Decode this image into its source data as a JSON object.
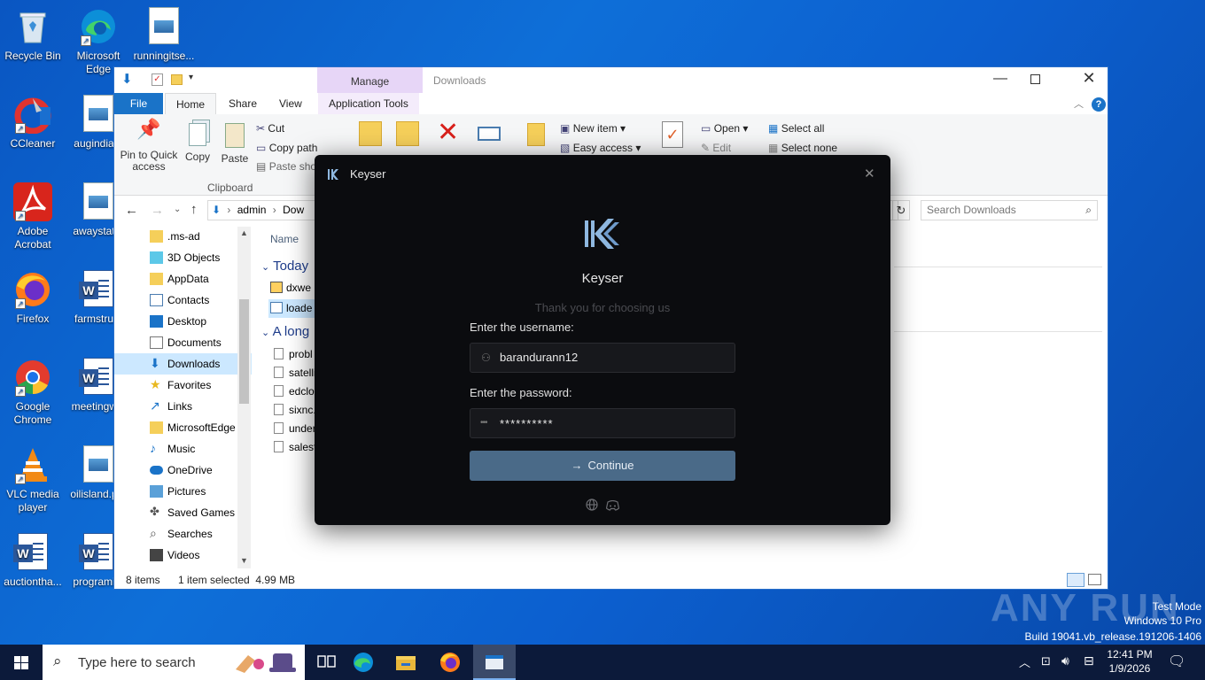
{
  "desktop": {
    "icons": [
      {
        "label": "Recycle Bin"
      },
      {
        "label": "Microsoft Edge"
      },
      {
        "label": "runningitse..."
      },
      {
        "label": "CCleaner"
      },
      {
        "label": "augindia..."
      },
      {
        "label": "Adobe Acrobat"
      },
      {
        "label": "awaystat..."
      },
      {
        "label": "Firefox"
      },
      {
        "label": "farmstru..."
      },
      {
        "label": "Google Chrome"
      },
      {
        "label": "meetingw..."
      },
      {
        "label": "VLC media player"
      },
      {
        "label": "oilisland.p..."
      },
      {
        "label": "auctiontha..."
      },
      {
        "label": "programi..."
      }
    ]
  },
  "explorer": {
    "window_title": "Downloads",
    "manage_label": "Manage",
    "tabs": [
      "File",
      "Home",
      "Share",
      "View",
      "Application Tools"
    ],
    "ribbon": {
      "pin_label": "Pin to Quick access",
      "copy_label": "Copy",
      "paste_label": "Paste",
      "cut_label": "Cut",
      "copy_path_label": "Copy path",
      "paste_shortcut_label": "Paste sho...",
      "clipboard_group": "Clipboard",
      "new_item_label": "New item",
      "easy_access_label": "Easy access",
      "open_label": "Open",
      "edit_label": "Edit",
      "select_all_label": "Select all",
      "select_none_label": "Select none"
    },
    "address": {
      "segments": [
        "admin",
        "Dow"
      ]
    },
    "search_placeholder": "Search Downloads",
    "sidebar": [
      {
        "label": ".ms-ad",
        "icon": "folder-icon"
      },
      {
        "label": "3D Objects",
        "icon": "3d-objects-icon"
      },
      {
        "label": "AppData",
        "icon": "folder-icon"
      },
      {
        "label": "Contacts",
        "icon": "contacts-icon"
      },
      {
        "label": "Desktop",
        "icon": "desktop-icon"
      },
      {
        "label": "Documents",
        "icon": "documents-icon"
      },
      {
        "label": "Downloads",
        "icon": "downloads-icon",
        "selected": true
      },
      {
        "label": "Favorites",
        "icon": "star-icon"
      },
      {
        "label": "Links",
        "icon": "links-icon"
      },
      {
        "label": "MicrosoftEdge",
        "icon": "folder-icon"
      },
      {
        "label": "Music",
        "icon": "music-icon"
      },
      {
        "label": "OneDrive",
        "icon": "cloud-icon"
      },
      {
        "label": "Pictures",
        "icon": "pictures-icon"
      },
      {
        "label": "Saved Games",
        "icon": "games-icon"
      },
      {
        "label": "Searches",
        "icon": "search-icon"
      },
      {
        "label": "Videos",
        "icon": "videos-icon"
      }
    ],
    "content": {
      "column_name": "Name",
      "group_today": "Today",
      "group_long": "A long",
      "today_files": [
        "dxwe",
        "loade"
      ],
      "long_files": [
        "probl",
        "satelli",
        "edclo",
        "sixnc.",
        "under",
        "salest"
      ]
    },
    "status": {
      "items": "8 items",
      "selected": "1 item selected  4.99 MB"
    }
  },
  "keyser": {
    "title": "Keyser",
    "app_name": "Keyser",
    "tagline": "Thank you for choosing us",
    "username_label": "Enter the username:",
    "username_value": "barandurann12",
    "password_label": "Enter the password:",
    "password_value": "**********",
    "continue_label": "Continue"
  },
  "taskbar": {
    "search_placeholder": "Type here to search",
    "time": "12:41 PM",
    "date": "1/9/2026"
  },
  "watermark": {
    "brand": "ANY RUN",
    "mode": "Test Mode",
    "os": "Windows 10 Pro",
    "build": "Build 19041.vb_release.191206-1406"
  },
  "colors": {
    "accent": "#0078d7",
    "dialog_bg": "#0b0c0f",
    "continue_button": "#4a6a88",
    "ribbon_manage": "#e7d6f7"
  }
}
